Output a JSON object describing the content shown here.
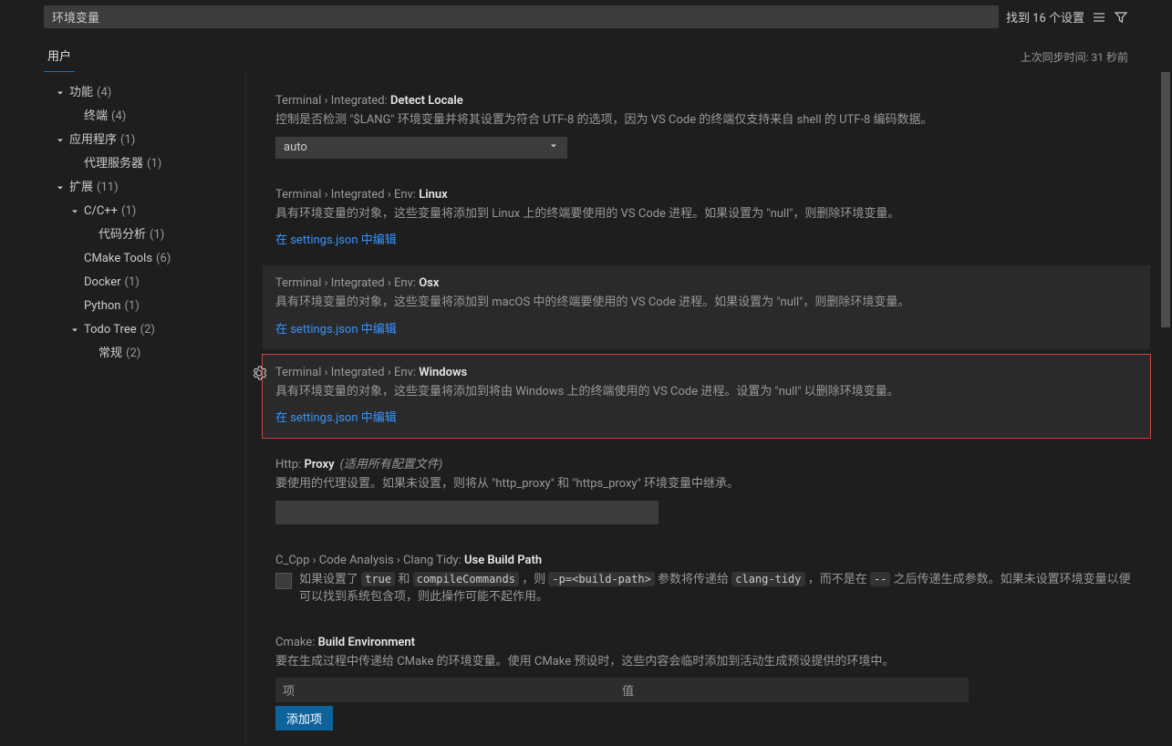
{
  "search": {
    "value": "环境变量",
    "result_text": "找到 16 个设置"
  },
  "tabs": {
    "user": "用户"
  },
  "sync_status": "上次同步时间: 31 秒前",
  "toc": {
    "features": {
      "label": "功能",
      "count": "(4)"
    },
    "terminal": {
      "label": "终端",
      "count": "(4)"
    },
    "apps": {
      "label": "应用程序",
      "count": "(1)"
    },
    "proxy": {
      "label": "代理服务器",
      "count": "(1)"
    },
    "extensions": {
      "label": "扩展",
      "count": "(11)"
    },
    "ccpp": {
      "label": "C/C++",
      "count": "(1)"
    },
    "codeAnalysis": {
      "label": "代码分析",
      "count": "(1)"
    },
    "cmake": {
      "label": "CMake Tools",
      "count": "(6)"
    },
    "docker": {
      "label": "Docker",
      "count": "(1)"
    },
    "python": {
      "label": "Python",
      "count": "(1)"
    },
    "todotree": {
      "label": "Todo Tree",
      "count": "(2)"
    },
    "general": {
      "label": "常规",
      "count": "(2)"
    }
  },
  "settings": {
    "detectLocale": {
      "crumb": "Terminal › Integrated: ",
      "name": "Detect Locale",
      "desc": "控制是否检测 \"$LANG\" 环境变量并将其设置为符合 UTF-8 的选项，因为 VS Code 的终端仅支持来自 shell 的 UTF-8 编码数据。",
      "value": "auto"
    },
    "envLinux": {
      "crumb": "Terminal › Integrated › Env: ",
      "name": "Linux",
      "desc": "具有环境变量的对象，这些变量将添加到 Linux 上的终端要使用的 VS Code 进程。如果设置为 \"null\"，则删除环境变量。",
      "link": "在 settings.json 中编辑"
    },
    "envOsx": {
      "crumb": "Terminal › Integrated › Env: ",
      "name": "Osx",
      "desc": "具有环境变量的对象，这些变量将添加到 macOS 中的终端要使用的 VS Code 进程。如果设置为 \"null\"，则删除环境变量。",
      "link": "在 settings.json 中编辑"
    },
    "envWindows": {
      "crumb": "Terminal › Integrated › Env: ",
      "name": "Windows",
      "desc": "具有环境变量的对象，这些变量将添加到将由 Windows 上的终端使用的 VS Code 进程。设置为 \"null\" 以删除环境变量。",
      "link": "在 settings.json 中编辑"
    },
    "httpProxy": {
      "crumb": "Http: ",
      "name": "Proxy",
      "scope": "(适用所有配置文件)",
      "desc": "要使用的代理设置。如果未设置，则将从 \"http_proxy\" 和 \"https_proxy\" 环境变量中继承。"
    },
    "clangTidy": {
      "crumb": "C_Cpp › Code Analysis › Clang Tidy: ",
      "name": "Use Build Path",
      "desc1": "如果设置了 ",
      "code1": "true",
      "desc2": " 和 ",
      "code2": "compileCommands",
      "desc3": " ，则 ",
      "code3": "-p=<build-path>",
      "desc4": " 参数将传递给 ",
      "code4": "clang-tidy",
      "desc5": " ，而不是在 ",
      "code5": "--",
      "desc6": " 之后传递生成参数。如果未设置环境变量以便可以找到系统包含项，则此操作可能不起作用。"
    },
    "cmakeBuildEnv": {
      "crumb": "Cmake: ",
      "name": "Build Environment",
      "desc": "要在生成过程中传递给 CMake 的环境变量。使用 CMake 预设时，这些内容会临时添加到活动生成预设提供的环境中。",
      "col1": "项",
      "col2": "值",
      "addBtn": "添加项"
    }
  }
}
